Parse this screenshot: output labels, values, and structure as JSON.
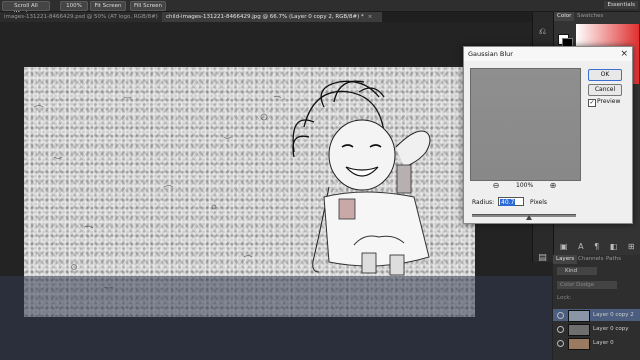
{
  "options_bar": {
    "buttons": [
      "Scroll All Windows",
      "100%",
      "Fit Screen",
      "Fill Screen"
    ],
    "workspace": "Essentials"
  },
  "tabs": [
    {
      "label": "images-131221-8466429.psd @ 50% (AT logo, RGB/8#)",
      "active": false
    },
    {
      "label": "child-images-131221-8466429.jpg @ 66.7% (Layer 0 copy 2, RGB/8#) *",
      "active": true
    }
  ],
  "tab_close": "×",
  "color_panel": {
    "tabs": [
      "Color",
      "Swatches"
    ]
  },
  "dialog": {
    "title": "Gaussian Blur",
    "close": "×",
    "ok": "OK",
    "cancel": "Cancel",
    "preview_label": "Preview",
    "preview_checked": true,
    "zoom_out": "⊖",
    "zoom_level": "100%",
    "zoom_in": "⊕",
    "radius_label": "Radius:",
    "radius_value": "40.7",
    "radius_unit": "Pixels"
  },
  "layers_panel": {
    "tabs": [
      "Layers",
      "Channels",
      "Paths"
    ],
    "kind_label": "Kind",
    "blend_mode": "Color Dodge",
    "lock_label": "Lock:",
    "layers": [
      {
        "name": "Layer 0 copy 2",
        "selected": true
      },
      {
        "name": "Layer 0 copy",
        "selected": false
      },
      {
        "name": "Layer 0",
        "selected": false
      }
    ]
  },
  "colors": {
    "accent": "#2a6ad6",
    "selected_layer": "#4b5e80"
  }
}
